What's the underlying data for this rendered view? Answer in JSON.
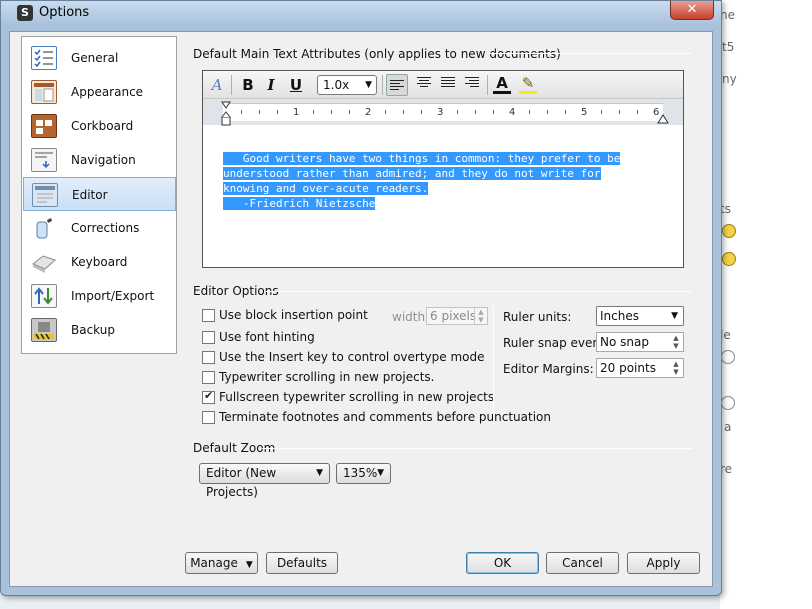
{
  "window": {
    "title": "Options",
    "app_icon_letter": "S",
    "close_glyph": "✕"
  },
  "background_fragments": [
    {
      "text": "ea"
    },
    {
      "text": "n"
    },
    {
      "text": "Co"
    },
    {
      "text": "t5"
    },
    {
      "text": "ny"
    },
    {
      "text": "ts"
    },
    {
      "text": "le"
    },
    {
      "text": "re"
    },
    {
      "text": "a"
    },
    {
      "text": "ne"
    }
  ],
  "sidebar": {
    "items": [
      {
        "label": "General",
        "icon": "checklist-icon",
        "color": "#4a7fc1"
      },
      {
        "label": "Appearance",
        "icon": "appearance-icon",
        "color": "#a05a2c"
      },
      {
        "label": "Corkboard",
        "icon": "corkboard-icon",
        "color": "#8b4a1e"
      },
      {
        "label": "Navigation",
        "icon": "navigation-icon",
        "color": "#6f8fb0"
      },
      {
        "label": "Editor",
        "icon": "editor-icon",
        "color": "#9fb8d6"
      },
      {
        "label": "Corrections",
        "icon": "corrections-icon",
        "color": "#5b9bd5"
      },
      {
        "label": "Keyboard",
        "icon": "keyboard-icon",
        "color": "#b0b0b0"
      },
      {
        "label": "Import/Export",
        "icon": "import-export-icon",
        "color": "#3a8a3a"
      },
      {
        "label": "Backup",
        "icon": "backup-icon",
        "color": "#e8c02a"
      }
    ],
    "selected": "Editor"
  },
  "text_attributes": {
    "title": "Default Main Text Attributes (only applies to new documents)",
    "format_bar": {
      "style_glyph": "A",
      "bold": "B",
      "italic": "I",
      "underline": "U",
      "line_spacing": "1.0x",
      "text_color_glyph": "A",
      "highlight_glyph": "✎",
      "dropdown_arrow": "▼"
    },
    "ruler_numbers": [
      "1",
      "2",
      "3",
      "4",
      "5",
      "6"
    ],
    "sample_text": {
      "line1": "   Good writers have two things in common: they prefer to be",
      "line2": "understood rather than admired; and they do not write for",
      "line3": "knowing and over-acute readers.",
      "line4": "   -Friedrich Nietzsche"
    }
  },
  "editor_options": {
    "title": "Editor Options",
    "checkboxes": [
      {
        "label": "Use block insertion point",
        "checked": false
      },
      {
        "label": "Use font hinting",
        "checked": false
      },
      {
        "label": "Use the Insert key to control overtype mode",
        "checked": false
      },
      {
        "label": "Typewriter scrolling in new projects.",
        "checked": false
      },
      {
        "label": "Fullscreen typewriter scrolling in new projects",
        "checked": true
      },
      {
        "label": "Terminate footnotes and comments before punctuation",
        "checked": false
      }
    ],
    "width_label": "width:",
    "width_value": "6 pixels",
    "ruler_units_label": "Ruler units:",
    "ruler_units_value": "Inches",
    "ruler_snap_label": "Ruler snap every:",
    "ruler_snap_value": "No snap",
    "margins_label": "Editor Margins:",
    "margins_value": "20 points",
    "spin_up": "▲",
    "spin_down": "▼"
  },
  "default_zoom": {
    "title": "Default Zoom",
    "scope": "Editor (New Projects)",
    "zoom": "135%"
  },
  "buttons": {
    "manage": "Manage",
    "defaults": "Defaults",
    "ok": "OK",
    "cancel": "Cancel",
    "apply": "Apply"
  }
}
